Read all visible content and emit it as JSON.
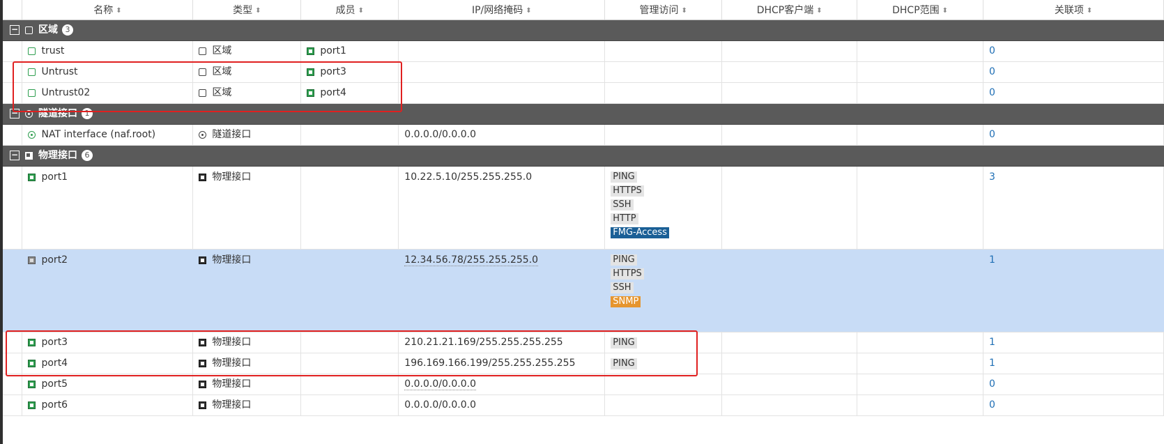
{
  "columns": [
    "名称",
    "类型",
    "成员",
    "IP/网络掩码",
    "管理访问",
    "DHCP客户端",
    "DHCP范围",
    "关联项"
  ],
  "sort_icon": "sort-icon",
  "groups": {
    "zone": {
      "label": "区域",
      "count": "3"
    },
    "tunnel": {
      "label": "隧道接口",
      "count": "1"
    },
    "physical": {
      "label": "物理接口",
      "count": "6"
    }
  },
  "rows": {
    "trust": {
      "name": "trust",
      "type": "区域",
      "member": "port1",
      "ip": "",
      "refs": "0"
    },
    "untrust": {
      "name": "Untrust",
      "type": "区域",
      "member": "port3",
      "ip": "",
      "refs": "0"
    },
    "untrust02": {
      "name": "Untrust02",
      "type": "区域",
      "member": "port4",
      "ip": "",
      "refs": "0"
    },
    "nat": {
      "name": "NAT interface (naf.root)",
      "type": "隧道接口",
      "member": "",
      "ip": "0.0.0.0/0.0.0.0",
      "refs": "0"
    },
    "port1": {
      "name": "port1",
      "type": "物理接口",
      "ip": "10.22.5.10/255.255.255.0",
      "access": [
        "PING",
        "HTTPS",
        "SSH",
        "HTTP"
      ],
      "access_special": "FMG-Access",
      "refs": "3"
    },
    "port2": {
      "name": "port2",
      "type": "物理接口",
      "ip": "12.34.56.78/255.255.255.0",
      "access": [
        "PING",
        "HTTPS",
        "SSH"
      ],
      "access_special": "SNMP",
      "refs": "1"
    },
    "port3": {
      "name": "port3",
      "type": "物理接口",
      "ip": "210.21.21.169/255.255.255.255",
      "access": [
        "PING"
      ],
      "refs": "1"
    },
    "port4": {
      "name": "port4",
      "type": "物理接口",
      "ip": "196.169.166.199/255.255.255.255",
      "access": [
        "PING"
      ],
      "refs": "1"
    },
    "port5": {
      "name": "port5",
      "type": "物理接口",
      "ip": "0.0.0.0/0.0.0.0",
      "refs": "0"
    },
    "port6": {
      "name": "port6",
      "type": "物理接口",
      "ip": "0.0.0.0/0.0.0.0",
      "refs": "0"
    }
  },
  "colors": {
    "group_bar": "#5a5a5a",
    "selected_row": "#c8dcf6",
    "link": "#1f6fb5",
    "highlight_box": "#e02020",
    "tag_blue": "#1a5f96",
    "tag_orange": "#e6952e"
  }
}
